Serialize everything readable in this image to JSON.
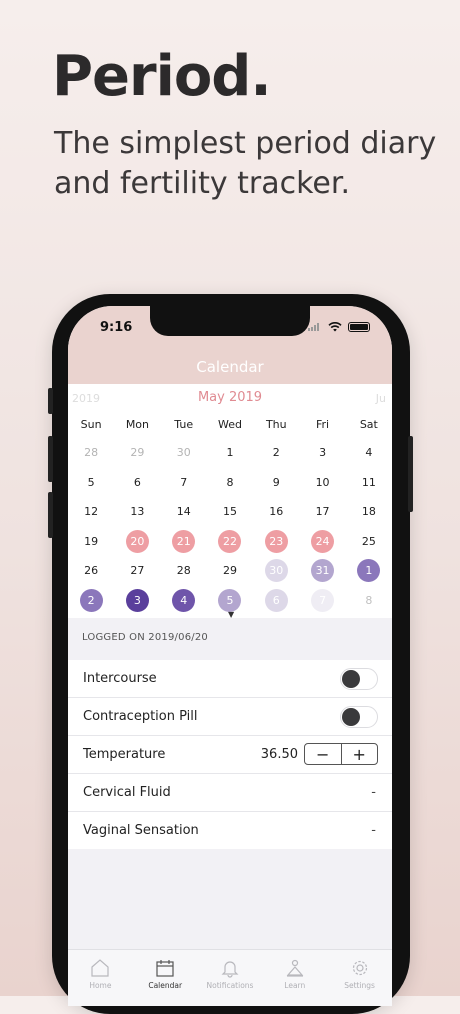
{
  "promo": {
    "headline": "Period.",
    "subtitle": "The simplest period diary and fertility tracker."
  },
  "status_bar": {
    "time": "9:16"
  },
  "nav": {
    "title": "Calendar"
  },
  "calendar": {
    "prev_month": "2019",
    "month": "May 2019",
    "next_month": "Ju",
    "weekdays": [
      "Sun",
      "Mon",
      "Tue",
      "Wed",
      "Thu",
      "Fri",
      "Sat"
    ],
    "days": [
      {
        "n": "28",
        "kind": "other"
      },
      {
        "n": "29",
        "kind": "other"
      },
      {
        "n": "30",
        "kind": "other"
      },
      {
        "n": "1",
        "kind": "normal"
      },
      {
        "n": "2",
        "kind": "normal"
      },
      {
        "n": "3",
        "kind": "normal"
      },
      {
        "n": "4",
        "kind": "normal"
      },
      {
        "n": "5",
        "kind": "normal"
      },
      {
        "n": "6",
        "kind": "normal"
      },
      {
        "n": "7",
        "kind": "normal"
      },
      {
        "n": "8",
        "kind": "normal"
      },
      {
        "n": "9",
        "kind": "normal"
      },
      {
        "n": "10",
        "kind": "normal"
      },
      {
        "n": "11",
        "kind": "normal"
      },
      {
        "n": "12",
        "kind": "normal"
      },
      {
        "n": "13",
        "kind": "normal"
      },
      {
        "n": "14",
        "kind": "normal"
      },
      {
        "n": "15",
        "kind": "normal"
      },
      {
        "n": "16",
        "kind": "normal"
      },
      {
        "n": "17",
        "kind": "normal"
      },
      {
        "n": "18",
        "kind": "normal"
      },
      {
        "n": "19",
        "kind": "normal"
      },
      {
        "n": "20",
        "kind": "period"
      },
      {
        "n": "21",
        "kind": "period"
      },
      {
        "n": "22",
        "kind": "period"
      },
      {
        "n": "23",
        "kind": "period"
      },
      {
        "n": "24",
        "kind": "period"
      },
      {
        "n": "25",
        "kind": "normal"
      },
      {
        "n": "26",
        "kind": "normal"
      },
      {
        "n": "27",
        "kind": "normal"
      },
      {
        "n": "28",
        "kind": "normal"
      },
      {
        "n": "29",
        "kind": "normal"
      },
      {
        "n": "30",
        "kind": "fert-1"
      },
      {
        "n": "31",
        "kind": "fert-2"
      },
      {
        "n": "1",
        "kind": "fert-3"
      },
      {
        "n": "2",
        "kind": "fert-3"
      },
      {
        "n": "3",
        "kind": "fert-5"
      },
      {
        "n": "4",
        "kind": "fert-4"
      },
      {
        "n": "5",
        "kind": "fert-2"
      },
      {
        "n": "6",
        "kind": "fert-1"
      },
      {
        "n": "7",
        "kind": "fert-0"
      },
      {
        "n": "8",
        "kind": "grey-next"
      }
    ],
    "colors": {
      "period": "#ee9ea3",
      "fertile_dark": "#5a3f9c",
      "fertile_light": "#ddd8e8",
      "header": "#ead3cf",
      "month_text": "#e08b92"
    }
  },
  "log": {
    "header": "LOGGED ON 2019/06/20",
    "rows": {
      "intercourse": {
        "label": "Intercourse",
        "on": false
      },
      "pill": {
        "label": "Contraception Pill",
        "on": false
      },
      "temperature": {
        "label": "Temperature",
        "value": "36.50",
        "minus": "−",
        "plus": "+"
      },
      "cervical": {
        "label": "Cervical Fluid",
        "value": "-"
      },
      "vaginal": {
        "label": "Vaginal Sensation",
        "value": "-"
      }
    }
  },
  "tabbar": {
    "items": [
      {
        "label": "Home",
        "icon": "home-icon"
      },
      {
        "label": "Calendar",
        "icon": "calendar-icon"
      },
      {
        "label": "Notifications",
        "icon": "bell-icon"
      },
      {
        "label": "Learn",
        "icon": "learn-icon"
      },
      {
        "label": "Settings",
        "icon": "gear-icon"
      }
    ],
    "active": "Calendar"
  }
}
